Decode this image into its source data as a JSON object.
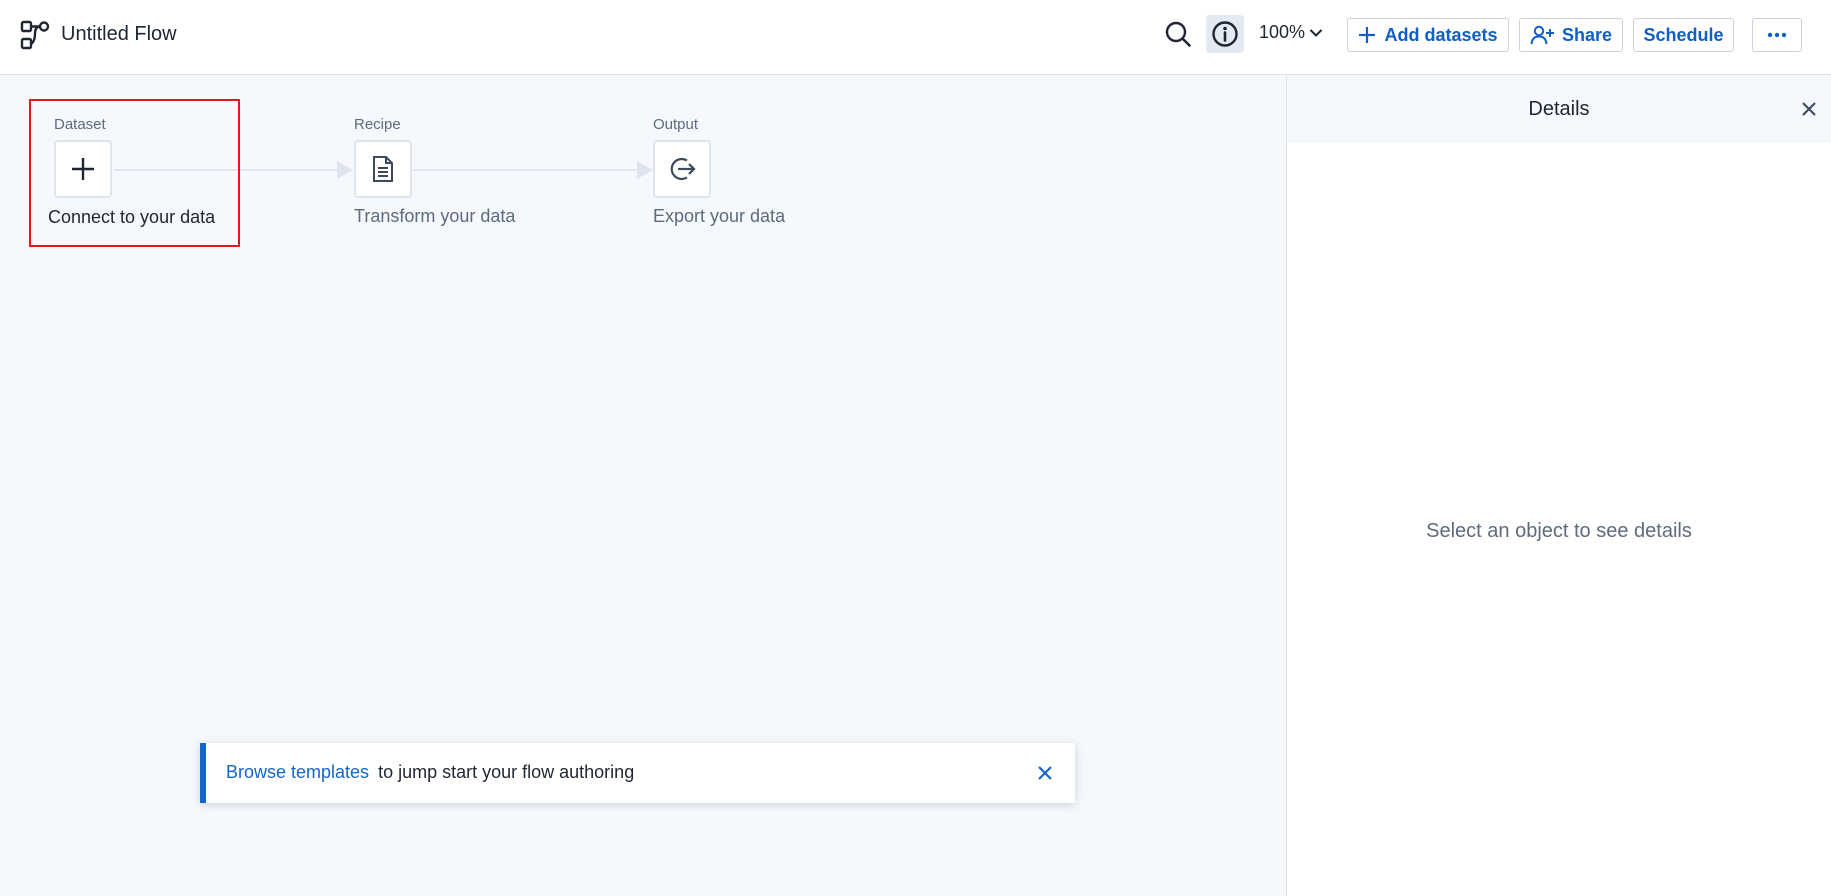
{
  "header": {
    "title": "Untitled Flow",
    "zoom": "100%",
    "add_datasets_label": "Add datasets",
    "share_label": "Share",
    "schedule_label": "Schedule"
  },
  "flow": {
    "stages": [
      {
        "label": "Dataset",
        "caption": "Connect to your data",
        "icon": "plus-icon"
      },
      {
        "label": "Recipe",
        "caption": "Transform your data",
        "icon": "document-icon"
      },
      {
        "label": "Output",
        "caption": "Export your data",
        "icon": "export-icon"
      }
    ]
  },
  "banner": {
    "link_text": "Browse templates",
    "text": "to jump start your flow authoring"
  },
  "details": {
    "title": "Details",
    "empty_message": "Select an object to see details"
  },
  "colors": {
    "accent": "#1565c8",
    "highlight": "#e3161b",
    "canvas_bg": "#f5f8fc"
  }
}
